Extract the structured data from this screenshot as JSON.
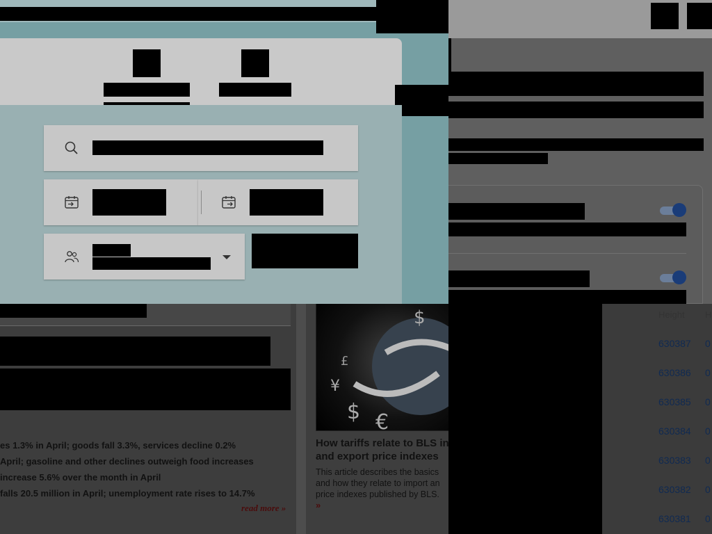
{
  "hotel_search": {
    "search_icon": "search-icon",
    "checkin_icon": "calendar-checkin-icon",
    "checkout_icon": "calendar-checkout-icon",
    "guests_icon": "guests-icon",
    "dropdown_icon": "caret-down-icon"
  },
  "settings": {
    "toggles": [
      {
        "state": "on",
        "color": "#1a3c78"
      },
      {
        "state": "on",
        "color": "#1a3c78"
      }
    ]
  },
  "news": {
    "lines": [
      "es 1.3% in April; goods fall 3.3%, services decline 0.2%",
      "April; gasoline and other declines outweigh food increases",
      " increase 5.6% over the month in April",
      " falls 20.5 million in April; unemployment rate rises to 14.7%"
    ],
    "read_more": "read more »"
  },
  "article": {
    "image_icon": "globe-currency-image",
    "title_line1": "How tariffs relate to BLS in",
    "title_line2": "and export price indexes",
    "desc_line1": "This article describes the basics",
    "desc_line2": "and how they relate to import an",
    "desc_line3": "price indexes published by BLS.",
    "more": "»"
  },
  "blocks": {
    "header_height": "Height",
    "header_next": "H",
    "rows": [
      {
        "height": "630387",
        "next": "0"
      },
      {
        "height": "630386",
        "next": "0"
      },
      {
        "height": "630385",
        "next": "0"
      },
      {
        "height": "630384",
        "next": "0"
      },
      {
        "height": "630383",
        "next": "0"
      },
      {
        "height": "630382",
        "next": "0"
      },
      {
        "height": "630381",
        "next": "0"
      }
    ]
  }
}
